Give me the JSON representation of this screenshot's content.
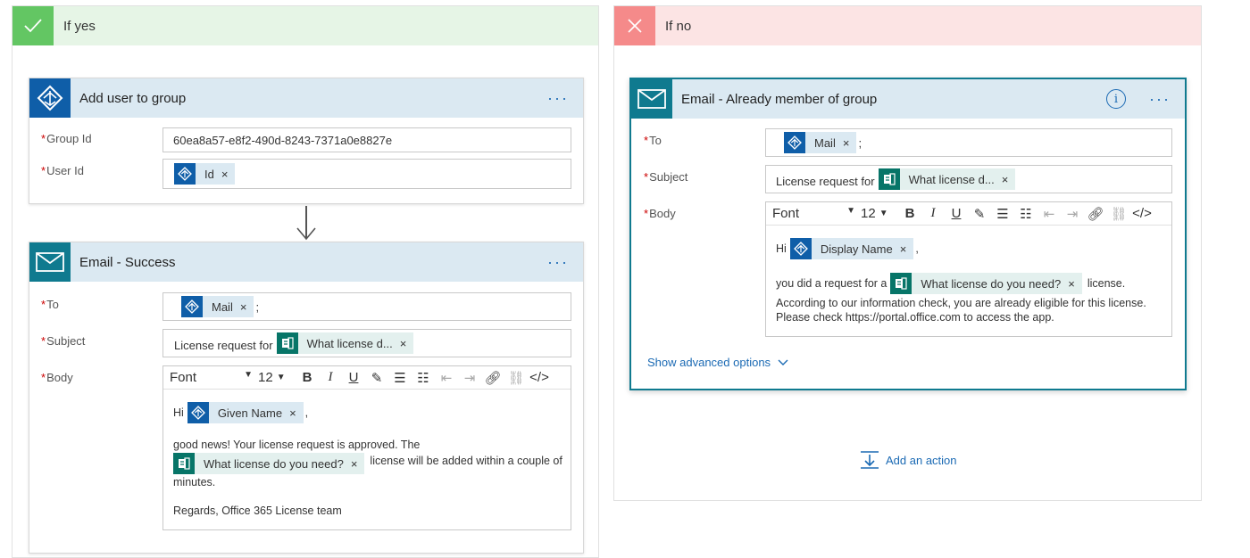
{
  "yes_branch": {
    "label": "If yes",
    "header_color": "#e6f5e6",
    "icon": "checkmark-icon",
    "add_user_card": {
      "title": "Add user to group",
      "more": "···",
      "group_id_label": "Group Id",
      "group_id_value": "60ea8a57-e8f2-490d-8243-7371a0e8827e",
      "user_id_label": "User Id",
      "user_id_token": "Id"
    },
    "email_card": {
      "title": "Email - Success",
      "more": "···",
      "to_label": "To",
      "to_token": "Mail",
      "to_sep": ";",
      "subject_label": "Subject",
      "subject_text": "License request for",
      "subject_token": "What license d...",
      "body_label": "Body",
      "body": {
        "hi": "Hi",
        "given_name_token": "Given Name",
        "comma": ",",
        "line2": "good news! Your license request is approved. The",
        "license_token": "What license do you need?",
        "line3_suffix": "license will be added within a couple of",
        "line4": "minutes.",
        "regards": "Regards, Office 365 License team"
      }
    }
  },
  "no_branch": {
    "label": "If no",
    "header_color": "#fce4e4",
    "icon": "close-icon",
    "email_card": {
      "title": "Email - Already member of group",
      "info": "i",
      "more": "···",
      "to_label": "To",
      "to_token": "Mail",
      "to_sep": ";",
      "subject_label": "Subject",
      "subject_text": "License request for",
      "subject_token": "What license d...",
      "body_label": "Body",
      "body": {
        "hi": "Hi",
        "display_name_token": "Display Name",
        "comma": ",",
        "line2_prefix": "you did a request for a",
        "license_token": "What license do you need?",
        "line2_suffix": "license.",
        "line3": "According to our information check, you are already eligible for this license.",
        "line4": "Please check https://portal.office.com to access the app."
      },
      "advanced": "Show advanced options"
    },
    "add_action": "Add an action"
  },
  "toolbar": {
    "font": "Font",
    "size": "12",
    "bold": "B",
    "italic": "I",
    "underline": "U",
    "code": "</>"
  },
  "chip_x": "×",
  "colors": {
    "accent": "#1b6ab4",
    "card_header": "#dbe9f2",
    "outlook_teal": "#0f7a8f",
    "yes_check_bg": "#63c663",
    "no_x_bg": "#f58a8a"
  }
}
